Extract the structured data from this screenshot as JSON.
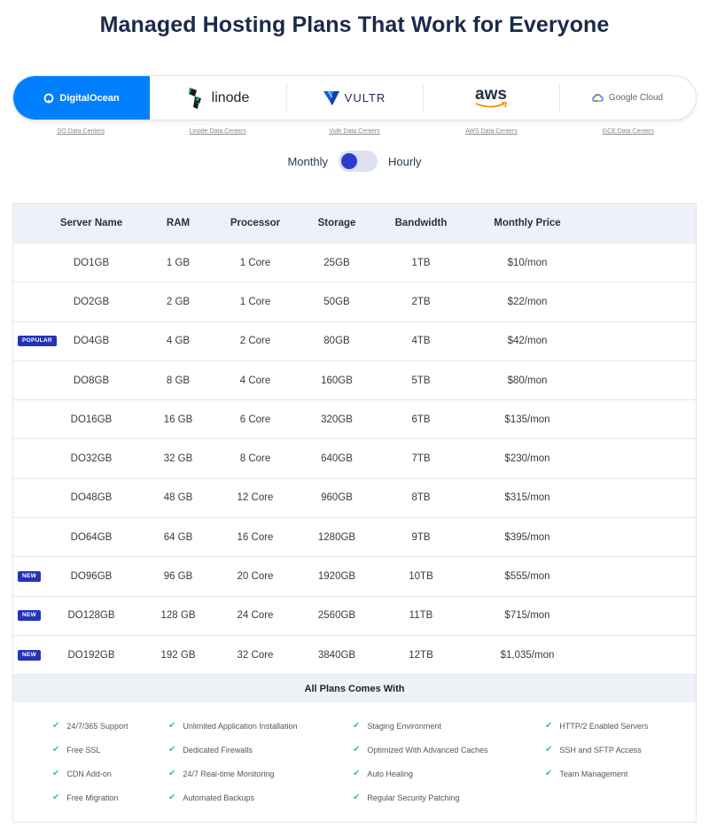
{
  "title": "Managed Hosting Plans That Work for Everyone",
  "providers": [
    {
      "name": "DigitalOcean",
      "icon": "digitalocean-logo-icon",
      "dc_link": "DO Data Centers",
      "active": true
    },
    {
      "name": "linode",
      "icon": "linode-logo-icon",
      "dc_link": "Linode Data Centers"
    },
    {
      "name": "VULTR",
      "icon": "vultr-logo-icon",
      "dc_link": "Vultr Data Centers"
    },
    {
      "name": "aws",
      "icon": "aws-logo-icon",
      "dc_link": "AWS Data Centers"
    },
    {
      "name": "Google Cloud",
      "icon": "google-cloud-logo-icon",
      "dc_link": "GCE Data Centers"
    }
  ],
  "billing_toggle": {
    "left_label": "Monthly",
    "right_label": "Hourly"
  },
  "table": {
    "headers": [
      "Server Name",
      "RAM",
      "Processor",
      "Storage",
      "Bandwidth",
      "Monthly Price"
    ],
    "rows": [
      {
        "badge": "",
        "name": "DO1GB",
        "ram": "1 GB",
        "cpu": "1 Core",
        "storage": "25GB",
        "bandwidth": "1TB",
        "price": "$10/mon"
      },
      {
        "badge": "",
        "name": "DO2GB",
        "ram": "2 GB",
        "cpu": "1 Core",
        "storage": "50GB",
        "bandwidth": "2TB",
        "price": "$22/mon"
      },
      {
        "badge": "POPULAR",
        "name": "DO4GB",
        "ram": "4 GB",
        "cpu": "2 Core",
        "storage": "80GB",
        "bandwidth": "4TB",
        "price": "$42/mon"
      },
      {
        "badge": "",
        "name": "DO8GB",
        "ram": "8 GB",
        "cpu": "4 Core",
        "storage": "160GB",
        "bandwidth": "5TB",
        "price": "$80/mon"
      },
      {
        "badge": "",
        "name": "DO16GB",
        "ram": "16 GB",
        "cpu": "6 Core",
        "storage": "320GB",
        "bandwidth": "6TB",
        "price": "$135/mon"
      },
      {
        "badge": "",
        "name": "DO32GB",
        "ram": "32 GB",
        "cpu": "8 Core",
        "storage": "640GB",
        "bandwidth": "7TB",
        "price": "$230/mon"
      },
      {
        "badge": "",
        "name": "DO48GB",
        "ram": "48 GB",
        "cpu": "12 Core",
        "storage": "960GB",
        "bandwidth": "8TB",
        "price": "$315/mon"
      },
      {
        "badge": "",
        "name": "DO64GB",
        "ram": "64 GB",
        "cpu": "16 Core",
        "storage": "1280GB",
        "bandwidth": "9TB",
        "price": "$395/mon"
      },
      {
        "badge": "NEW",
        "name": "DO96GB",
        "ram": "96 GB",
        "cpu": "20 Core",
        "storage": "1920GB",
        "bandwidth": "10TB",
        "price": "$555/mon"
      },
      {
        "badge": "NEW",
        "name": "DO128GB",
        "ram": "128 GB",
        "cpu": "24 Core",
        "storage": "2560GB",
        "bandwidth": "11TB",
        "price": "$715/mon"
      },
      {
        "badge": "NEW",
        "name": "DO192GB",
        "ram": "192 GB",
        "cpu": "32 Core",
        "storage": "3840GB",
        "bandwidth": "12TB",
        "price": "$1,035/mon"
      }
    ]
  },
  "plans": {
    "heading": "All Plans Comes With",
    "columns": [
      [
        "24/7/365 Support",
        "Free SSL",
        "CDN Add-on",
        "Free Migration"
      ],
      [
        "Unlimited Application Installation",
        "Dedicated Firewalls",
        "24/7 Real-time Monitoring",
        "Automated Backups"
      ],
      [
        "Staging Environment",
        "Optimized With Advanced Caches",
        "Auto Healing",
        "Regular Security Patching"
      ],
      [
        "HTTP/2 Enabled Servers",
        "SSH and SFTP Access",
        "Team Management"
      ]
    ]
  },
  "colors": {
    "accent": "#0080ff",
    "badge": "#2533b8",
    "check": "#3cc39a",
    "title": "#1b2a4a"
  }
}
